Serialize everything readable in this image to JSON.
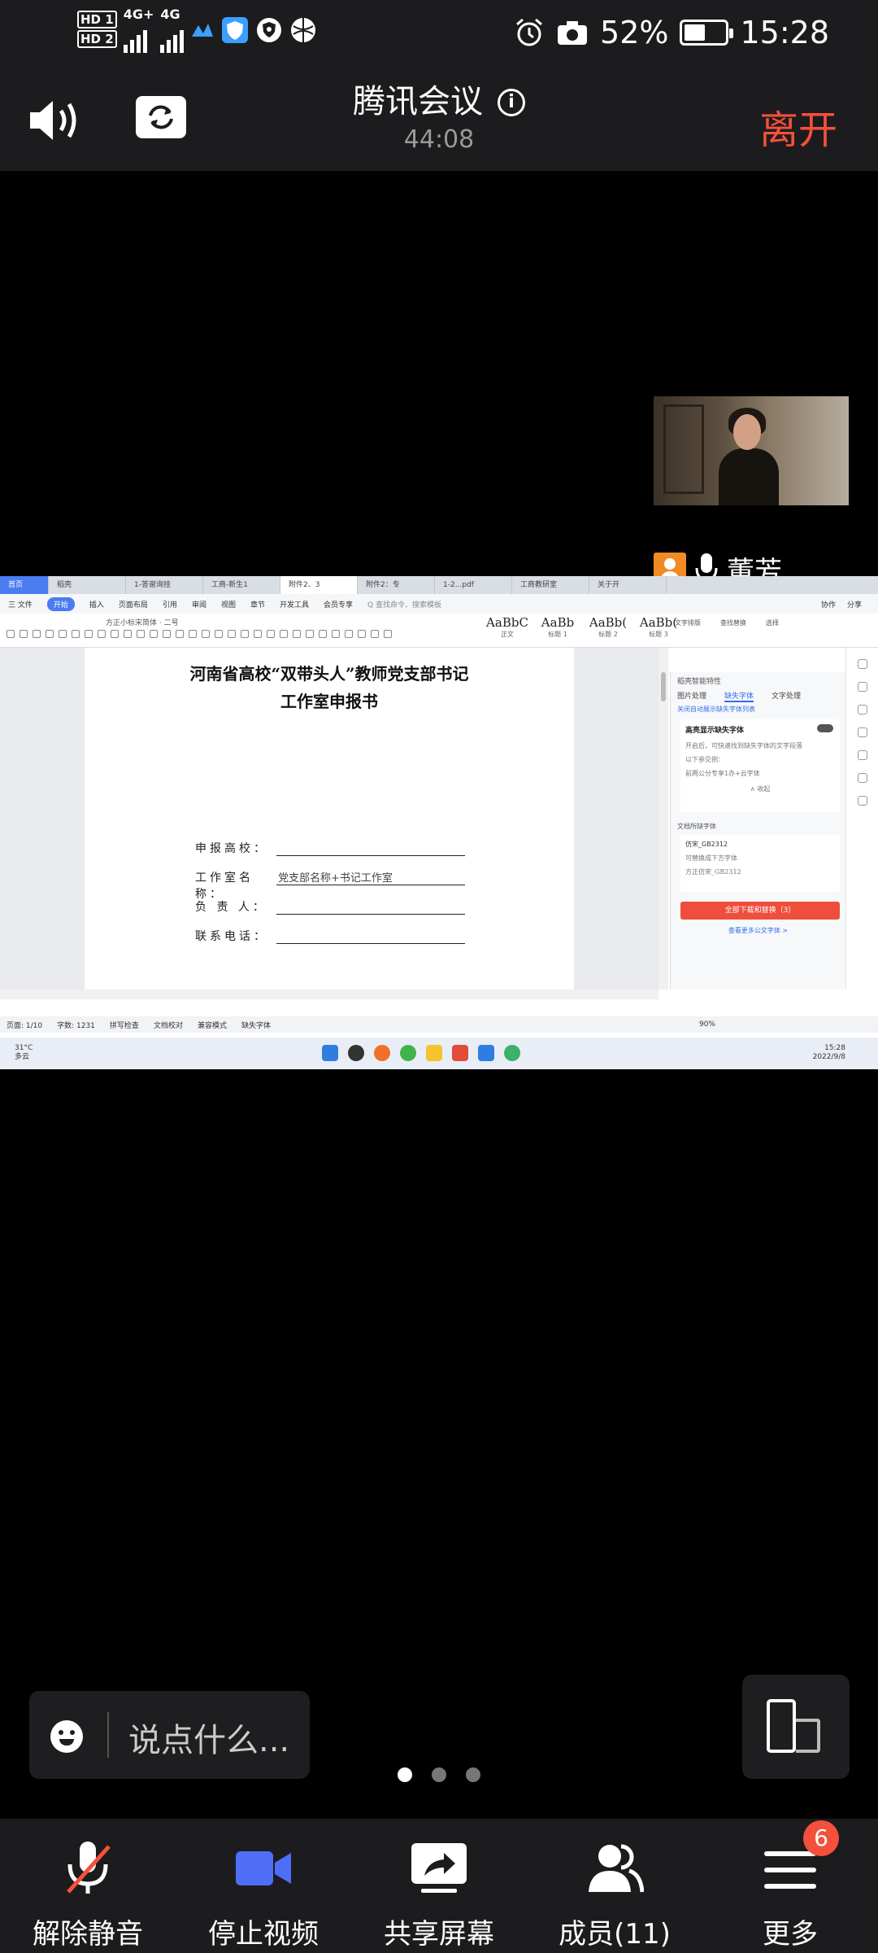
{
  "status_bar": {
    "hd1": "HD",
    "sim1": "1",
    "hd2": "HD",
    "sim2": "2",
    "net1": "4G+",
    "net2": "4G",
    "battery_percent": "52%",
    "battery_level": 0.52,
    "time": "15:28"
  },
  "meeting": {
    "title": "腾讯会议",
    "duration": "44:08",
    "leave_label": "离开",
    "speaker_name": "董芳"
  },
  "shared_screen": {
    "tabs": [
      "首页",
      "稻壳",
      "1-答谢询挂",
      "工商-新生1",
      "附件2、3",
      "附件2：专",
      "1-2...pdf",
      "工商教研室",
      "关于开"
    ],
    "menu": [
      "三 文件",
      "开始",
      "插入",
      "页面布局",
      "引用",
      "审阅",
      "视图",
      "章节",
      "开发工具",
      "会员专享",
      "Q 查找命令、搜索模板"
    ],
    "menu_right": [
      "协作",
      "分享"
    ],
    "font_name": "方正小标宋简体",
    "font_size": "二号",
    "styles": [
      {
        "sample": "AaBbC",
        "name": "正文"
      },
      {
        "sample": "AaBb",
        "name": "标题 1"
      },
      {
        "sample": "AaBb(",
        "name": "标题 2"
      },
      {
        "sample": "AaBb(",
        "name": "标题 3"
      }
    ],
    "tools": [
      "文字排版",
      "查找替换",
      "选择"
    ],
    "doc": {
      "title_line1": "河南省高校“双带头人”教师党支部书记",
      "title_line2": "工作室申报书",
      "fields": [
        {
          "label": "申报高校：",
          "value": ""
        },
        {
          "label": "工作室名称：",
          "value": "党支部名称+书记工作室"
        },
        {
          "label": "负 责 人：",
          "value": ""
        },
        {
          "label": "联系电话：",
          "value": ""
        }
      ]
    },
    "panel": {
      "header": "稻壳智能特性",
      "tabs": [
        "图片处理",
        "缺失字体",
        "文字处理"
      ],
      "link": "关闭自动展示缺失字体列表",
      "card_title": "高亮显示缺失字体",
      "card_text1": "开启后，可快速找到缺失字体的文字段落",
      "card_text2": "以下参见例：",
      "card_text3": "前两公分专享1办+云字体",
      "collapse": "∧ 收起",
      "section": "文档所缺字体",
      "missing_font": "仿宋_GB2312",
      "missing_hint": "可替换成下方字体",
      "replacement": "方正仿宋_GB2312",
      "download_btn": "全部下载和替换（3）",
      "more_link": "查看更多公文字体 >"
    },
    "status": {
      "page": "页面: 1/10",
      "words": "字数: 1231",
      "spell": "拼写检查",
      "proof": "文档校对",
      "compat": "兼容模式",
      "missing": "缺失字体",
      "zoom": "90%"
    },
    "taskbar": {
      "temp": "31°C",
      "weather": "多云",
      "clock_time": "15:28",
      "clock_date": "2022/9/8"
    }
  },
  "chat": {
    "placeholder": "说点什么..."
  },
  "toolbar": {
    "items": [
      {
        "label": "解除静音"
      },
      {
        "label": "停止视频"
      },
      {
        "label": "共享屏幕"
      },
      {
        "label": "成员(11)"
      },
      {
        "label": "更多"
      }
    ],
    "more_badge": "6"
  },
  "colors": {
    "leave": "#f4503b",
    "video_icon": "#4f6ef7",
    "badge": "#f4503b",
    "speaker_avatar": "#f08a24",
    "wps_accent": "#4a7cf0",
    "panel_button": "#ef4e3d"
  }
}
